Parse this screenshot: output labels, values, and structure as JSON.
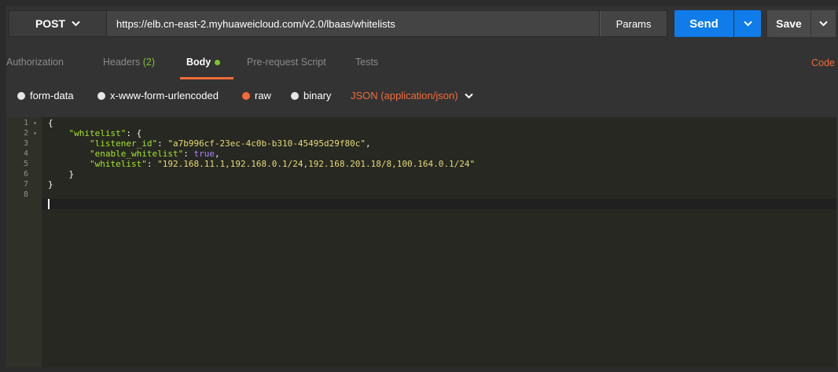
{
  "request": {
    "method": "POST",
    "url": "https://elb.cn-east-2.myhuaweicloud.com/v2.0/lbaas/whitelists",
    "params_label": "Params",
    "send_label": "Send",
    "save_label": "Save"
  },
  "tabs": {
    "authorization": "Authorization",
    "headers": "Headers",
    "headers_count": "(2)",
    "body": "Body",
    "prerequest": "Pre-request Script",
    "tests": "Tests",
    "code": "Code"
  },
  "body_options": {
    "form_data": "form-data",
    "urlencoded": "x-www-form-urlencoded",
    "raw": "raw",
    "binary": "binary",
    "selected": "raw",
    "content_type": "JSON (application/json)"
  },
  "editor": {
    "line_numbers": [
      "1",
      "2",
      "3",
      "4",
      "5",
      "6",
      "7",
      "8"
    ],
    "lines": [
      {
        "open": "{"
      },
      {
        "key": "\"whitelist\"",
        "rest": ": {"
      },
      {
        "key": "\"listener_id\"",
        "sep": ": ",
        "value": "\"a7b996cf-23ec-4c0b-b310-45495d29f80c\"",
        "end": ","
      },
      {
        "key": "\"enable_whitelist\"",
        "sep": ": ",
        "bool": "true",
        "end": ","
      },
      {
        "key": "\"whitelist\"",
        "sep": ": ",
        "value": "\"192.168.11.1,192.168.0.1/24,192.168.201.18/8,100.164.0.1/24\""
      },
      {
        "close": "}"
      },
      {
        "close": "}"
      }
    ]
  },
  "colors": {
    "accent_orange": "#f26b3a",
    "send_blue": "#0f7ce9",
    "count_green": "#7ec42c",
    "json_key": "#a6e22e",
    "json_string": "#e6db74",
    "json_bool": "#ae81ff"
  }
}
